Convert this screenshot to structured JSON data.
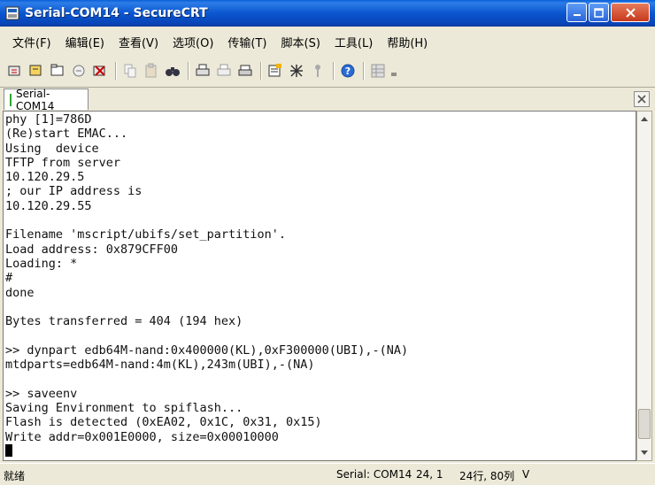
{
  "window": {
    "title": "Serial-COM14 - SecureCRT"
  },
  "menu": {
    "items": [
      {
        "label": "文件(F)"
      },
      {
        "label": "编辑(E)"
      },
      {
        "label": "查看(V)"
      },
      {
        "label": "选项(O)"
      },
      {
        "label": "传输(T)"
      },
      {
        "label": "脚本(S)"
      },
      {
        "label": "工具(L)"
      },
      {
        "label": "帮助(H)"
      }
    ]
  },
  "tab": {
    "label": "Serial-COM14"
  },
  "terminal": {
    "lines": [
      "phy [1]=786D",
      "(Re)start EMAC...",
      "Using  device",
      "TFTP from server",
      "10.120.29.5",
      "; our IP address is",
      "10.120.29.55",
      "",
      "Filename 'mscript/ubifs/set_partition'.",
      "Load address: 0x879CFF00",
      "Loading: *",
      "#",
      "done",
      "",
      "Bytes transferred = 404 (194 hex)",
      "",
      ">> dynpart edb64M-nand:0x400000(KL),0xF300000(UBI),-(NA)",
      "mtdparts=edb64M-nand:4m(KL),243m(UBI),-(NA)",
      "",
      ">> saveenv",
      "Saving Environment to spiflash...",
      "Flash is detected (0xEA02, 0x1C, 0x31, 0x15)",
      "Write addr=0x001E0000, size=0x00010000"
    ]
  },
  "status": {
    "ready": "就绪",
    "connection": "Serial: COM14",
    "cursor": "24,  1",
    "size": "24行, 80列",
    "term": "V"
  },
  "colors": {
    "titlebar": "#0b56d0",
    "chrome": "#ece9d8",
    "terminal_bg": "#ffffff",
    "terminal_fg": "#111111"
  }
}
